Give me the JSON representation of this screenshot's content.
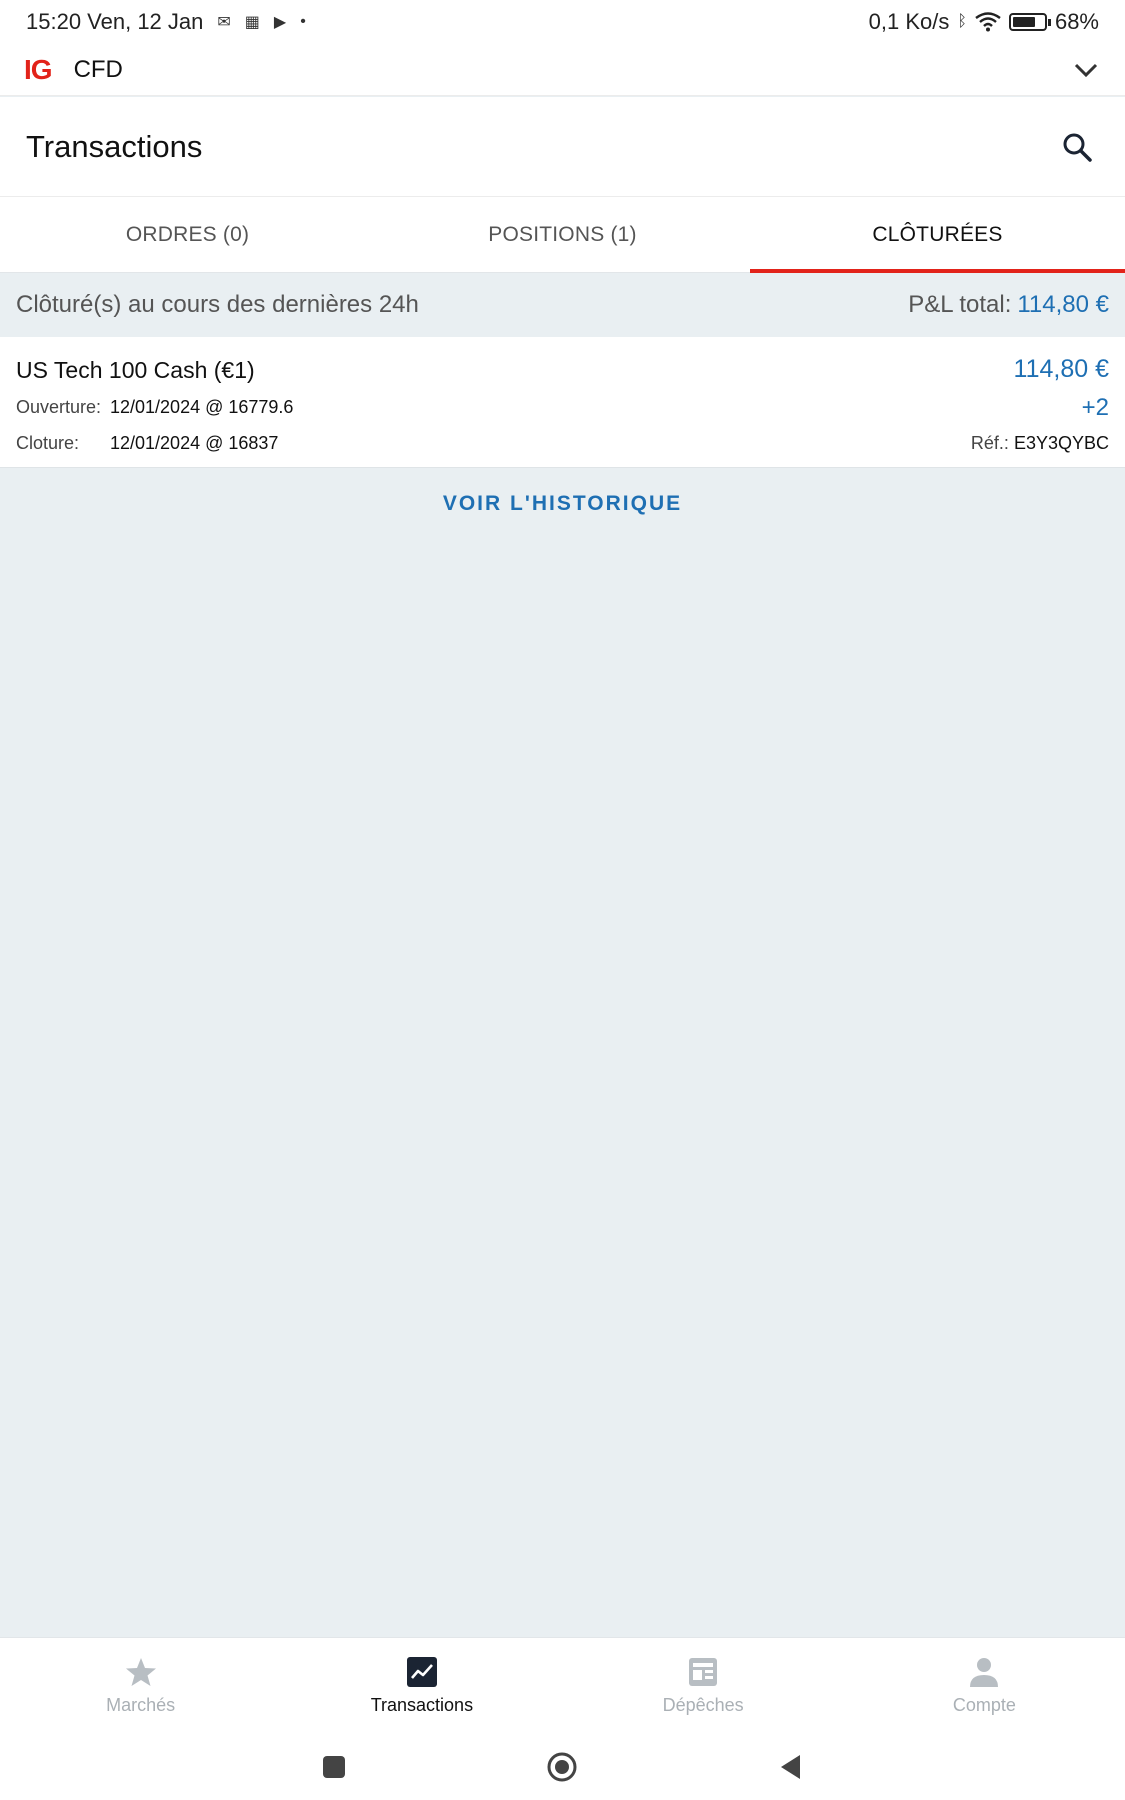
{
  "statusbar": {
    "time_date": "15:20 Ven, 12 Jan",
    "net_speed": "0,1 Ko/s",
    "battery": "68%"
  },
  "appbar": {
    "logo": "IG",
    "account_type": "CFD",
    "chevron_icon": "chevron-down-icon"
  },
  "header": {
    "title": "Transactions",
    "search_icon": "search-icon"
  },
  "tabs": [
    {
      "label": "ORDRES (0)",
      "active": false
    },
    {
      "label": "POSITIONS (1)",
      "active": false
    },
    {
      "label": "CLÔTURÉES",
      "active": true
    }
  ],
  "summary": {
    "label": "Clôturé(s) au cours des dernières 24h",
    "pl_label": "P&L total:",
    "pl_value": "114,80 €"
  },
  "closed_trade": {
    "instrument": "US Tech 100 Cash (€1)",
    "pnl": "114,80 €",
    "open_label": "Ouverture:",
    "open_value": "12/01/2024 @ 16779.6",
    "close_label": "Cloture:",
    "close_value": "12/01/2024 @ 16837",
    "size": "+2",
    "ref_label": "Réf.:",
    "ref_value": "E3Y3QYBC"
  },
  "history_link": "VOIR L'HISTORIQUE",
  "bottom_nav": [
    {
      "label": "Marchés",
      "icon": "star-icon",
      "active": false
    },
    {
      "label": "Transactions",
      "icon": "chart-line-icon",
      "active": true
    },
    {
      "label": "Dépêches",
      "icon": "newspaper-icon",
      "active": false
    },
    {
      "label": "Compte",
      "icon": "person-icon",
      "active": false
    }
  ],
  "colors": {
    "brand_red": "#e2231a",
    "link_blue": "#1e6fb3",
    "background": "#e9eff2"
  }
}
